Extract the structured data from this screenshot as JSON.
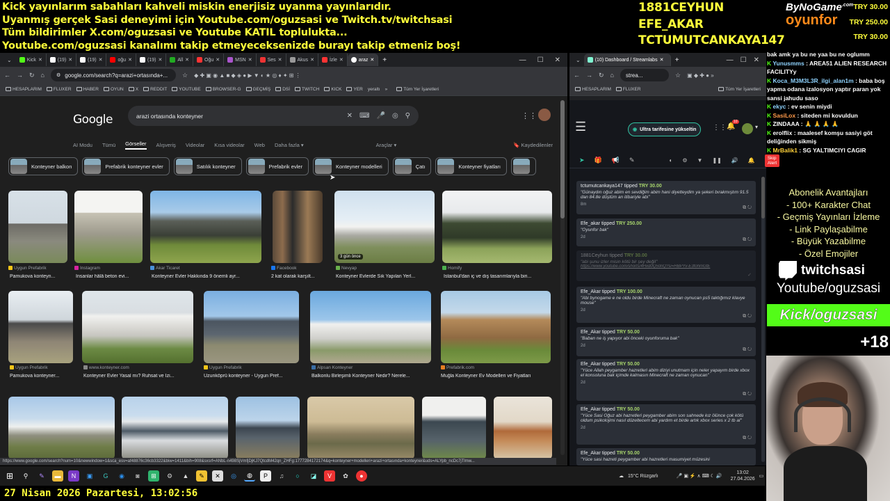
{
  "overlay": {
    "banner_lines": [
      "Kick yayınlarım sabahları kahveli miskin enerjisiz uyanma yayınlarıdır.",
      "Uyanmış gerçek Sasi deneyimi için Youtube.com/oguzsasi ve Twitch.tv/twitchsasi",
      "Tüm bildirimler X.com/oguzsasi ve Youtube KATIL toplulukta...",
      "Youtube.com/oguzsasi kanalımı takip etmeyeceksenizde burayı takip etmeniz boş!"
    ],
    "top_donors": [
      "1881CEYHUN",
      "EFE_AKAR",
      "TCTUMUTCANKAYA147"
    ],
    "logo_line1": "ByNoGame",
    "logo_line1_suffix": ".com",
    "logo_line2": "oyunfor",
    "tip_amounts": [
      "TRY 30.00",
      "TRY 250.00",
      "TRY 30.00"
    ],
    "date_time": "27 Nisan 2026 Pazartesi, 13:02:56",
    "plus_count": "+18"
  },
  "browser1": {
    "tabs": [
      "Kick",
      "(19)",
      "(19)",
      "oğu",
      "(19)",
      "All",
      "Oğu",
      "MSN",
      "Ses",
      "Akus",
      "İzle",
      "araz"
    ],
    "url": "google.com/search?q=arazi+ortasında+...",
    "bookmarks": [
      "HESAPLARIM",
      "FLUXER",
      "HABER",
      "OYUN",
      "X",
      "REDDIT",
      "YOUTUBE",
      "BROWSER-G",
      "GEÇMİŞ",
      "DSİ",
      "TWITCH",
      "KICK",
      "YER",
      "yeraltı",
      "Tüm Yer İşaretleri"
    ],
    "status_url": "https://www.google.com/search?num=10&newwindow=1&sca_esv=af48876c36cb3322&biw=1411&bih=908&sxsrf=ANbL-n498SjVmfjDjKJ7QtcdM42qn_ZHFg:1777284172174&q=konteyner+modelleri+arazi+ortasında+konteyner&uds=ALYpb_ncDc7jTlmw..."
  },
  "google": {
    "logo": "Google",
    "query": "arazi ortasında konteyner",
    "tabs": [
      "AI Modu",
      "Tümü",
      "Görseller",
      "Alışveriş",
      "Videolar",
      "Kısa videolar",
      "Web",
      "Daha fazla ▾"
    ],
    "active_tab": "Görseller",
    "tools": "Araçlar ▾",
    "saved": "Kaydedilenler",
    "chips": [
      "Konteyner balkon",
      "Prefabrik konteyner evler",
      "Satılık konteyner",
      "Prefabrik evler",
      "Konteyner modelleri",
      "Çatı",
      "Konteyner fiyatları"
    ],
    "results": [
      {
        "source": "Uygun Prefabrik",
        "title": "Pamukova konteyn..."
      },
      {
        "source": "Instagram",
        "title": "İnsanlar hâlâ beton evi..."
      },
      {
        "source": "Akar Ticaret",
        "title": "Konteyner Evler Hakkında 9 önemli ayr..."
      },
      {
        "source": "Facebook",
        "title": "2 kat olarak karşılt..."
      },
      {
        "source": "Nevyap",
        "title": "Konteyner Evlerde Sık Yapılan Yerl...",
        "badge": "3 gün önce"
      },
      {
        "source": "Homify",
        "title": "İstanbul'dan iç ve dış tasarımlarıyla biri..."
      },
      {
        "source": "Uygun Prefabrik",
        "title": "Pamukova konteyner..."
      },
      {
        "source": "www.konteyner.com",
        "title": "Konteyner Evler Yasal mı? Ruhsat ve İzi..."
      },
      {
        "source": "Uygun Prefabrik",
        "title": "Uzunköprü konteyner - Uygun Pref..."
      },
      {
        "source": "Alpsan Konteyner",
        "title": "Balkonlu Birleşimli Konteyner Nedir? Nerele..."
      },
      {
        "source": "Prefabrik.com",
        "title": "Muğla Konteyner Ev Modelleri ve Fiyatları"
      }
    ]
  },
  "browser2": {
    "tab": "(10) Dashboard / Streamlabs",
    "url": "strea...",
    "bookmarks": [
      "HESAPLARIM",
      "FLUXER",
      "Tüm Yer İşaretleri"
    ],
    "upgrade_label": "Ultra tarifesine yükseltin",
    "notif_count": "10",
    "skip_alert": "Skip Alert",
    "alerts": [
      {
        "user": "tctumutcankaya147",
        "verb": "tipped",
        "amount": "TRY 30.00",
        "msg": "\"Günaydın oğuz abim en sevdiğim abim hani diyetteydim ya şekeri bırakmıştım 91.5 dan 84.8e düştüm an itibariyle abi\"",
        "time": "8m"
      },
      {
        "user": "Efe_akar",
        "verb": "tipped",
        "amount": "TRY 250.00",
        "msg": "\"Oyunfor bak\"",
        "time": "2d"
      },
      {
        "user": "1881Ceyhun",
        "verb": "tipped",
        "amount": "TRY 30.00",
        "msg": "\"abi şunu izler misin kötü bir şey değil\"",
        "link": "https://www.youtube.com/shorts/4Hxd0Q50nQ?si=HBPYv-E3fohmGtE",
        "time": ""
      },
      {
        "user": "Efe_Akar",
        "verb": "tipped",
        "amount": "TRY 100.00",
        "msg": "\"Abi bynogame e ne oldu birde Minecraft ne zaman oynucan ps5 taktığımız klavye mouse\"",
        "time": "2d"
      },
      {
        "user": "Efe_Akar",
        "verb": "tipped",
        "amount": "TRY 50.00",
        "msg": "\"Baban ne iş yapıyor abi önceki oyunforuma bak\"",
        "time": "2d"
      },
      {
        "user": "Efe_Akar",
        "verb": "tipped",
        "amount": "TRY 50.00",
        "msg": "\"Yüce Allah peygamber hazretleri abim diziyi unutmam için neler yapayım birde xbox el konsoluna bak içimde kalmasın Minecraft ne zaman oynucan\"",
        "time": "2d"
      },
      {
        "user": "Efe_Akar",
        "verb": "tipped",
        "amount": "TRY 50.00",
        "msg": "\"Yüce Sasi Oğuz abi hazretleri peygamber abim son sahnede kız ölünce çok kötü oldum psikolojimi nasıl düzeltecem abi yardım et birde artık xbox series x 2 tb al\"",
        "time": "2d"
      },
      {
        "user": "Efe_Akar",
        "verb": "tipped",
        "amount": "TRY 50.00",
        "msg": "\"Yüce sasi hazreti peygamber abi hazretleri masumiyet müzesini",
        "time": ""
      }
    ]
  },
  "chat": [
    {
      "user": "",
      "text": "bak amk ya bu ne yaa bu ne oglumm",
      "color": "#ffffff"
    },
    {
      "user": "Yunusmms",
      "text": "AREA51 ALIEN RESEARCH FACILITYy",
      "color": "#8fd3ff"
    },
    {
      "user": "Koca_M3M3L3R_ilgi_alan1m",
      "text": "baba boş yapma odana izalosyon yaptır paran yok sansi jahudu saso",
      "color": "#8fd3ff"
    },
    {
      "user": "ekyc",
      "text": "ev senin miydi",
      "color": "#8fd3ff"
    },
    {
      "user": "SasiLox",
      "text": "siteden mi kovuldun",
      "color": "#ff9a4a"
    },
    {
      "user": "ZINDAAA",
      "text": "🙏 🙏 🙏 🙏",
      "color": "#ffffff"
    },
    {
      "user": "erolflix",
      "text": "maalesef komşu sasiyi göt deliğinden sikmiş",
      "color": "#ffffff"
    },
    {
      "user": "MrBalik1",
      "text": "SG YALTIMCIYI CAGIR",
      "color": "#ffd23a"
    }
  ],
  "subs_benefits": [
    "Abonelik Avantajları",
    "- 100+ Karakter Chat",
    "- Geçmiş Yayınları İzleme",
    "- Link Paylaşabilme",
    "- Büyük Yazabilme",
    "- Özel Emojiler"
  ],
  "socials": {
    "twitch": "twitchsasi",
    "youtube": "Youtube/oguzsasi",
    "kick_prefix": "Kick/",
    "kick_name": "oguzsasi"
  },
  "tray": {
    "weather": "15°C  Rüzgarlı",
    "time": "13:02",
    "date": "27.04.2026"
  }
}
